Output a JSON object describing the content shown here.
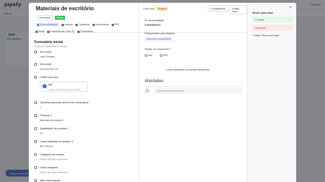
{
  "background": {
    "logo": "pipefy",
    "tab": "Ativos",
    "user": "Empresa",
    "column_title": "Em análise",
    "card_date": "Ontem",
    "new_button": "Nova solicitação"
  },
  "modal": {
    "title": "Materiais de escritório",
    "badges": [
      "Velocidade",
      "Prazo"
    ],
    "toolbar": [
      {
        "label": "Nova solicitação",
        "active": true
      },
      {
        "label": "Anexos"
      },
      {
        "label": "Checklists"
      },
      {
        "label": "Comentários"
      },
      {
        "label": "PDF"
      }
    ],
    "toolbar2": [
      {
        "label": "Email"
      },
      {
        "label": "Conexões do Card",
        "count": "0"
      },
      {
        "label": "Formulários"
      }
    ],
    "form": {
      "title": "Formulário inicial",
      "subtitle": "Criado por Pipefy • há 20 minutos",
      "fields": [
        {
          "label": "Seu nome",
          "value": "Joao Trindade",
          "type": "text"
        },
        {
          "label": "Seu email",
          "value": "joao@pipefy.com",
          "type": "link"
        },
        {
          "label": "Centro de custo",
          "type": "connection",
          "conn_name": "BH",
          "conn_date": "Criado em 20 de fevereiro de 2021"
        },
        {
          "label": "*Quantos produtos devem ser comprados?",
          "value": "1",
          "type": "text"
        },
        {
          "label": "*Produto 1",
          "value": "Materiais de escritório",
          "type": "text"
        },
        {
          "label": "Quantidade do produto 1",
          "value": "20",
          "type": "text"
        },
        {
          "label": "Custo estimado do produto 1",
          "value": "R$ 1.000,00",
          "type": "text"
        },
        {
          "label": "Categoria da compra",
          "value": "Clique aqui para adicionar",
          "type": "muted"
        },
        {
          "label": "Outra categoria",
          "value": "Clique aqui para adicionar",
          "type": "muted"
        },
        {
          "label": "Mais informações",
          "value": "",
          "type": "text"
        }
      ]
    },
    "middle": {
      "phase_label": "Fase atual",
      "phase_value": "Triagem",
      "share_button": "Compartilhar",
      "edit_button": "Editar fase",
      "request_code_label": "ID da solicitação",
      "request_code_value": "#484860070",
      "responsible_label": "Responsável pela triagem",
      "add_responsible": "Adicionar responsável",
      "budget_label": "Dentro do orçamento?",
      "yes": "Sim",
      "no": "Não",
      "customize": "+ para customizar os campos desta fase",
      "activities_title": "Atividades",
      "comment_placeholder": "Escreva seu comentário..."
    },
    "right": {
      "move_title": "Mover para fase",
      "phase_green": "Compra",
      "phase_red": "Arquivado",
      "arrow": "→",
      "move_link": "+ Editar \"Mover para fase\""
    }
  }
}
